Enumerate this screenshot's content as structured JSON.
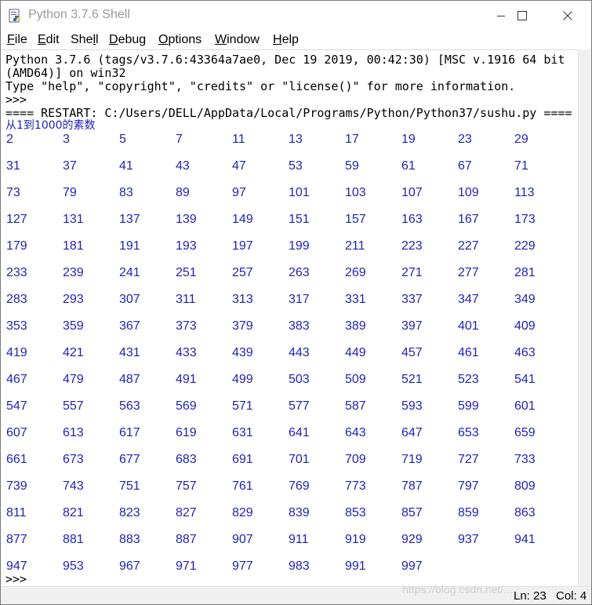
{
  "window": {
    "title": "Python 3.7.6 Shell"
  },
  "menu": [
    {
      "pre": "",
      "u": "F",
      "post": "ile"
    },
    {
      "pre": "",
      "u": "E",
      "post": "dit"
    },
    {
      "pre": "She",
      "u": "l",
      "post": "l"
    },
    {
      "pre": "",
      "u": "D",
      "post": "ebug"
    },
    {
      "pre": "",
      "u": "O",
      "post": "ptions"
    },
    {
      "pre": "",
      "u": "W",
      "post": "indow"
    },
    {
      "pre": "",
      "u": "H",
      "post": "elp"
    }
  ],
  "shell": {
    "banner1": "Python 3.7.6 (tags/v3.7.6:43364a7ae0, Dec 19 2019, 00:42:30) [MSC v.1916 64 bit",
    "banner2": "(AMD64)] on win32",
    "banner3": "Type \"help\", \"copyright\", \"credits\" or \"license()\" for more information.",
    "prompt1": ">>>",
    "restart": "==== RESTART: C:/Users/DELL/AppData/Local/Programs/Python/Python37/sushu.py ====",
    "heading": "从1到1000的素数",
    "primes": [
      "2",
      "3",
      "5",
      "7",
      "11",
      "13",
      "17",
      "19",
      "23",
      "29",
      "31",
      "37",
      "41",
      "43",
      "47",
      "53",
      "59",
      "61",
      "67",
      "71",
      "73",
      "79",
      "83",
      "89",
      "97",
      "101",
      "103",
      "107",
      "109",
      "113",
      "127",
      "131",
      "137",
      "139",
      "149",
      "151",
      "157",
      "163",
      "167",
      "173",
      "179",
      "181",
      "191",
      "193",
      "197",
      "199",
      "211",
      "223",
      "227",
      "229",
      "233",
      "239",
      "241",
      "251",
      "257",
      "263",
      "269",
      "271",
      "277",
      "281",
      "283",
      "293",
      "307",
      "311",
      "313",
      "317",
      "331",
      "337",
      "347",
      "349",
      "353",
      "359",
      "367",
      "373",
      "379",
      "383",
      "389",
      "397",
      "401",
      "409",
      "419",
      "421",
      "431",
      "433",
      "439",
      "443",
      "449",
      "457",
      "461",
      "463",
      "467",
      "479",
      "487",
      "491",
      "499",
      "503",
      "509",
      "521",
      "523",
      "541",
      "547",
      "557",
      "563",
      "569",
      "571",
      "577",
      "587",
      "593",
      "599",
      "601",
      "607",
      "613",
      "617",
      "619",
      "631",
      "641",
      "643",
      "647",
      "653",
      "659",
      "661",
      "673",
      "677",
      "683",
      "691",
      "701",
      "709",
      "719",
      "727",
      "733",
      "739",
      "743",
      "751",
      "757",
      "761",
      "769",
      "773",
      "787",
      "797",
      "809",
      "811",
      "821",
      "823",
      "827",
      "829",
      "839",
      "853",
      "857",
      "859",
      "863",
      "877",
      "881",
      "883",
      "887",
      "907",
      "911",
      "919",
      "929",
      "937",
      "941",
      "947",
      "953",
      "967",
      "971",
      "977",
      "983",
      "991",
      "997"
    ],
    "prompt2": ">>>"
  },
  "status": {
    "line": "Ln: 23",
    "col": "Col: 4"
  },
  "watermark": "https://blog.csdn.net/..."
}
